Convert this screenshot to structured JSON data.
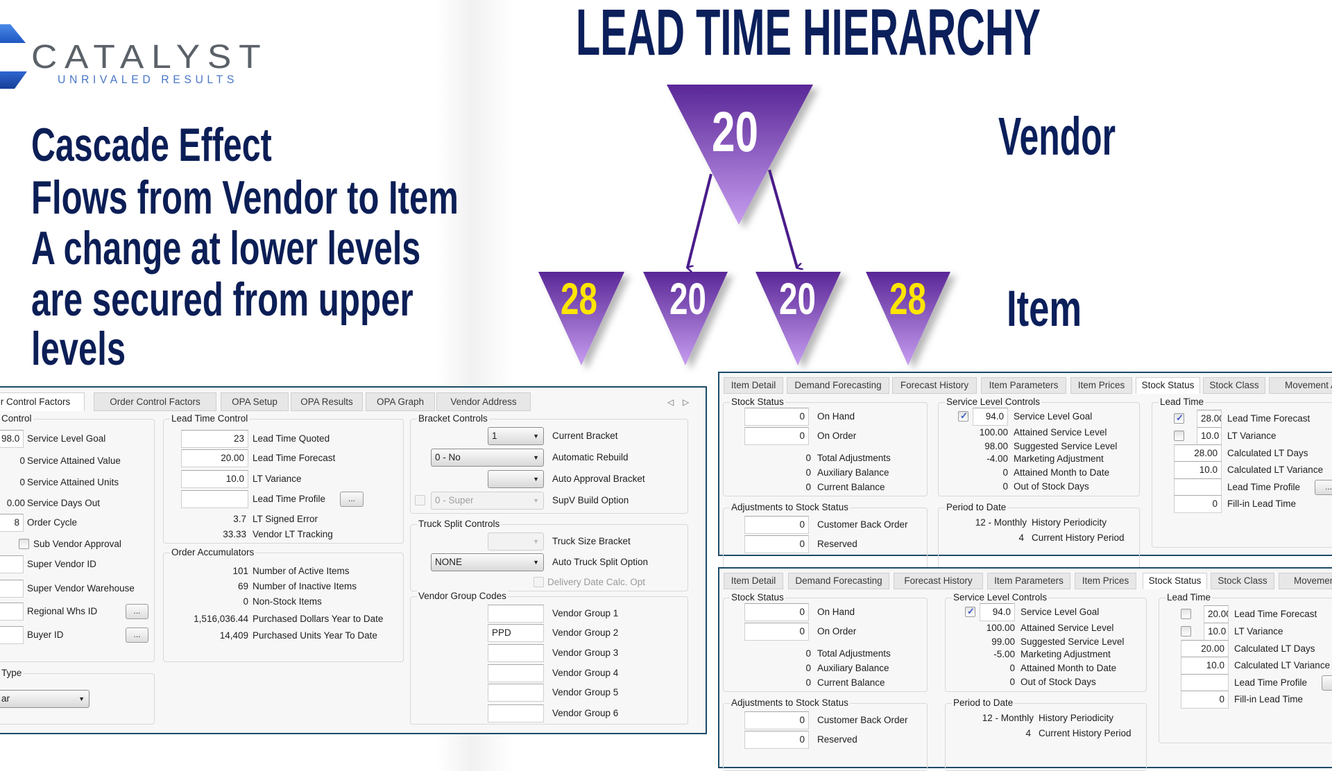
{
  "logo": {
    "name": "CATALYST",
    "tagline": "UNRIVALED RESULTS",
    "colors": {
      "text": "#5b6168",
      "tagline": "#4a78c8",
      "mark": "#2a63d0"
    }
  },
  "title": "LEAD TIME HIERARCHY",
  "bullets": [
    "Cascade Effect",
    "Flows from Vendor to Item",
    "A change at lower levels",
    "are secured from upper",
    "levels"
  ],
  "hierarchy": {
    "vendor_label": "Vendor",
    "item_label": "Item",
    "vendor_value": "20",
    "item_values": [
      "28",
      "20",
      "20",
      "28"
    ],
    "item_highlight": [
      true,
      false,
      false,
      true
    ],
    "colors": {
      "triangle_top": "#5a2797",
      "triangle_bottom": "#c79ef0",
      "arrow": "#4a1c8a",
      "highlight_text": "#ffe500",
      "text": "#ffffff",
      "heading": "#0b1f5b"
    }
  },
  "vendor_panel": {
    "tabs": [
      "r Control Factors",
      "Order Control Factors",
      "OPA Setup",
      "OPA Results",
      "OPA Graph",
      "Vendor Address"
    ],
    "active_tab": "r Control Factors",
    "control": {
      "title": "Control",
      "browse_label": "...",
      "fields": [
        {
          "value": "98.0",
          "label": "Service Level Goal"
        },
        {
          "value": "0",
          "label": "Service Attained Value"
        },
        {
          "value": "0",
          "label": "Service Attained Units"
        },
        {
          "value": "0.00",
          "label": "Service Days Out"
        },
        {
          "value": "8",
          "label": "Order Cycle"
        },
        {
          "label": "Sub Vendor Approval",
          "checked": false
        },
        {
          "value": "",
          "label": "Super Vendor ID"
        },
        {
          "value": "",
          "label": "Super Vendor Warehouse"
        },
        {
          "value": "",
          "label": "Regional Whs ID"
        },
        {
          "value": "",
          "label": "Buyer ID"
        }
      ]
    },
    "type_group": {
      "title": "Type",
      "selected": "ar"
    },
    "lead_time_control": {
      "title": "Lead Time Control",
      "browse_label": "...",
      "fields": [
        {
          "value": "23",
          "label": "Lead Time Quoted"
        },
        {
          "value": "20.00",
          "label": "Lead Time Forecast"
        },
        {
          "value": "10.0",
          "label": "LT Variance"
        },
        {
          "value": "",
          "label": "Lead Time Profile"
        },
        {
          "value": "3.7",
          "label": "LT Signed Error"
        },
        {
          "value": "33.33",
          "label": "Vendor LT Tracking"
        }
      ]
    },
    "order_accumulators": {
      "title": "Order Accumulators",
      "fields": [
        {
          "value": "101",
          "label": "Number of Active Items"
        },
        {
          "value": "69",
          "label": "Number of Inactive Items"
        },
        {
          "value": "0",
          "label": "Non-Stock Items"
        },
        {
          "value": "1,516,036.44",
          "label": "Purchased Dollars Year to Date"
        },
        {
          "value": "14,409",
          "label": "Purchased Units Year To Date"
        }
      ]
    },
    "bracket_controls": {
      "title": "Bracket Controls",
      "fields": [
        {
          "selected": "1",
          "label": "Current Bracket"
        },
        {
          "selected": "0 - No",
          "label": "Automatic Rebuild"
        },
        {
          "selected": "",
          "label": "Auto Approval Bracket"
        },
        {
          "selected": "0 - Super",
          "label": "SupV Build Option",
          "checked": false,
          "disabled": true
        }
      ]
    },
    "truck_split_controls": {
      "title": "Truck Split Controls",
      "fields": [
        {
          "selected": "",
          "label": "Truck Size Bracket",
          "disabled": true
        },
        {
          "selected": "NONE",
          "label": "Auto Truck Split Option"
        },
        {
          "label": "Delivery Date Calc. Opt",
          "checked": false,
          "disabled": true
        }
      ]
    },
    "vendor_group_codes": {
      "title": "Vendor Group Codes",
      "fields": [
        {
          "value": "",
          "label": "Vendor Group 1"
        },
        {
          "value": "PPD",
          "label": "Vendor Group 2"
        },
        {
          "value": "",
          "label": "Vendor Group 3"
        },
        {
          "value": "",
          "label": "Vendor Group 4"
        },
        {
          "value": "",
          "label": "Vendor Group 5"
        },
        {
          "value": "",
          "label": "Vendor Group 6"
        }
      ]
    }
  },
  "item_panels": [
    {
      "tabs": [
        "Item Detail",
        "Demand Forecasting",
        "Forecast History",
        "Item Parameters",
        "Item Prices",
        "Stock Status",
        "Stock Class",
        "Movement A"
      ],
      "active_tab": "Stock Status",
      "stock_status": {
        "title": "Stock Status",
        "fields": [
          {
            "value": "0",
            "label": "On Hand"
          },
          {
            "value": "0",
            "label": "On Order"
          },
          {
            "value": "0",
            "label": "Total Adjustments"
          },
          {
            "value": "0",
            "label": "Auxiliary Balance"
          },
          {
            "value": "0",
            "label": "Current Balance"
          }
        ]
      },
      "adjustments": {
        "title": "Adjustments to Stock Status",
        "fields": [
          {
            "value": "0",
            "label": "Customer Back Order"
          },
          {
            "value": "0",
            "label": "Reserved"
          }
        ]
      },
      "service_level_controls": {
        "title": "Service Level Controls",
        "fields": [
          {
            "value": "94.0",
            "label": "Service Level Goal",
            "checked": true
          },
          {
            "value": "100.00",
            "label": "Attained Service Level"
          },
          {
            "value": "98.00",
            "label": "Suggested Service Level"
          },
          {
            "value": "-4.00",
            "label": "Marketing Adjustment"
          },
          {
            "value": "0",
            "label": "Attained Month to Date"
          },
          {
            "value": "0",
            "label": "Out of Stock Days"
          }
        ]
      },
      "period_to_date": {
        "title": "Period to Date",
        "fields": [
          {
            "value": "12 - Monthly",
            "label": "History Periodicity"
          },
          {
            "value": "4",
            "label": "Current History Period"
          }
        ]
      },
      "lead_time": {
        "title": "Lead Time",
        "browse_label": "...",
        "fields": [
          {
            "value": "28.00",
            "label": "Lead Time Forecast",
            "checked": true
          },
          {
            "value": "10.0",
            "label": "LT Variance",
            "checked": false
          },
          {
            "value": "28.00",
            "label": "Calculated LT Days"
          },
          {
            "value": "10.0",
            "label": "Calculated LT Variance"
          },
          {
            "value": "",
            "label": "Lead Time Profile"
          },
          {
            "value": "0",
            "label": "Fill-in Lead Time"
          }
        ]
      }
    },
    {
      "tabs": [
        "Item Detail",
        "Demand Forecasting",
        "Forecast History",
        "Item Parameters",
        "Item Prices",
        "Stock Status",
        "Stock Class",
        "Movement"
      ],
      "active_tab": "Stock Status",
      "stock_status": {
        "title": "Stock Status",
        "fields": [
          {
            "value": "0",
            "label": "On Hand"
          },
          {
            "value": "0",
            "label": "On Order"
          },
          {
            "value": "0",
            "label": "Total Adjustments"
          },
          {
            "value": "0",
            "label": "Auxiliary Balance"
          },
          {
            "value": "0",
            "label": "Current Balance"
          }
        ]
      },
      "adjustments": {
        "title": "Adjustments to Stock Status",
        "fields": [
          {
            "value": "0",
            "label": "Customer Back Order"
          },
          {
            "value": "0",
            "label": "Reserved"
          }
        ]
      },
      "service_level_controls": {
        "title": "Service Level Controls",
        "fields": [
          {
            "value": "94.0",
            "label": "Service Level Goal",
            "checked": true
          },
          {
            "value": "100.00",
            "label": "Attained Service Level"
          },
          {
            "value": "99.00",
            "label": "Suggested Service Level"
          },
          {
            "value": "-5.00",
            "label": "Marketing Adjustment"
          },
          {
            "value": "0",
            "label": "Attained Month to Date"
          },
          {
            "value": "0",
            "label": "Out of Stock Days"
          }
        ]
      },
      "period_to_date": {
        "title": "Period to Date",
        "fields": [
          {
            "value": "12 - Monthly",
            "label": "History Periodicity"
          },
          {
            "value": "4",
            "label": "Current History Period"
          }
        ]
      },
      "lead_time": {
        "title": "Lead Time",
        "browse_label": "...",
        "fields": [
          {
            "value": "20.00",
            "label": "Lead Time Forecast",
            "checked": false
          },
          {
            "value": "10.0",
            "label": "LT Variance",
            "checked": false
          },
          {
            "value": "20.00",
            "label": "Calculated LT Days"
          },
          {
            "value": "10.0",
            "label": "Calculated LT Variance"
          },
          {
            "value": "",
            "label": "Lead Time Profile"
          },
          {
            "value": "0",
            "label": "Fill-in Lead Time"
          }
        ]
      }
    }
  ]
}
